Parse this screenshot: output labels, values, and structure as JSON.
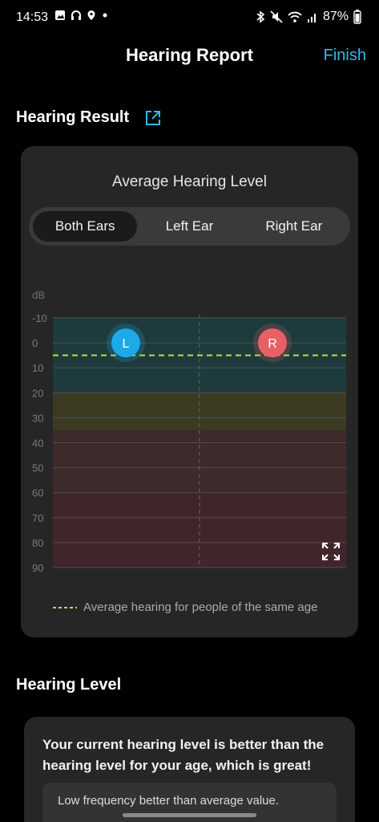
{
  "status_bar": {
    "time": "14:53",
    "battery": "87%",
    "left_icons": [
      "image-icon",
      "headphones-icon",
      "location-icon",
      "dot-icon"
    ],
    "right_icons": [
      "bluetooth-icon",
      "mute-icon",
      "wifi-icon",
      "signal-icon"
    ]
  },
  "header": {
    "title": "Hearing Report",
    "finish_label": "Finish",
    "accent_color": "#36b9e6"
  },
  "hearing_result": {
    "section_title": "Hearing Result",
    "card_title": "Average Hearing Level",
    "tabs": [
      {
        "label": "Both Ears",
        "active": true
      },
      {
        "label": "Left Ear",
        "active": false
      },
      {
        "label": "Right Ear",
        "active": false
      }
    ],
    "legend_text": "Average hearing for people of the same age"
  },
  "chart_data": {
    "type": "scatter",
    "ylabel": "dB",
    "y_ticks": [
      "-10",
      "0",
      "10",
      "20",
      "30",
      "40",
      "50",
      "60",
      "70",
      "80",
      "90"
    ],
    "ylim": [
      -10,
      90
    ],
    "y_inverted": true,
    "zones": [
      {
        "from": -10,
        "to": 20,
        "color": "#1d3a3c"
      },
      {
        "from": 20,
        "to": 35,
        "color": "#3c3a22"
      },
      {
        "from": 35,
        "to": 60,
        "color": "#3d2a2a"
      },
      {
        "from": 60,
        "to": 90,
        "color": "#40262a"
      }
    ],
    "series": [
      {
        "name": "L",
        "value": 0,
        "color": "#1ea9e8"
      },
      {
        "name": "R",
        "value": 0,
        "color": "#e86067"
      }
    ],
    "reference_line": {
      "value": 5,
      "color": "#c8d84a"
    }
  },
  "hearing_level": {
    "section_title": "Hearing Level",
    "summary": "Your current hearing level is better than the hearing level for your age, which is great!",
    "detail": "Low frequency better than average value."
  }
}
